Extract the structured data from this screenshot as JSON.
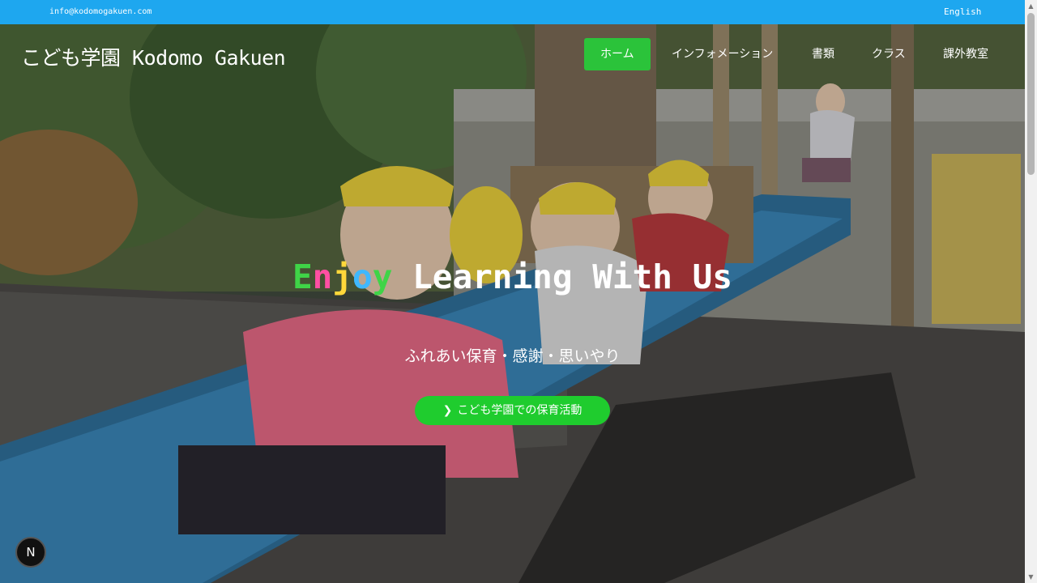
{
  "topbar": {
    "email": "info@kodomogakuen.com",
    "language": "English",
    "color": "#1ea7ef"
  },
  "brand": {
    "name": "こども学園 Kodomo Gakuen"
  },
  "nav": {
    "items": [
      {
        "label": "ホーム",
        "active": true
      },
      {
        "label": "インフォメーション",
        "active": false
      },
      {
        "label": "書類",
        "active": false
      },
      {
        "label": "クラス",
        "active": false
      },
      {
        "label": "課外教室",
        "active": false
      }
    ],
    "active_color": "#2bc33a"
  },
  "hero": {
    "headline_colored": [
      "E",
      "n",
      "j",
      "o",
      "y"
    ],
    "headline_rest": " Learning With Us",
    "tagline": "ふれあい保育・感謝・思いやり",
    "cta_label": "こども学園での保育活動",
    "cta_icon": "chevron-right-icon",
    "cta_color": "#1fcc2e",
    "background": "photo of children on playground slide"
  },
  "badge": {
    "letter": "N"
  }
}
